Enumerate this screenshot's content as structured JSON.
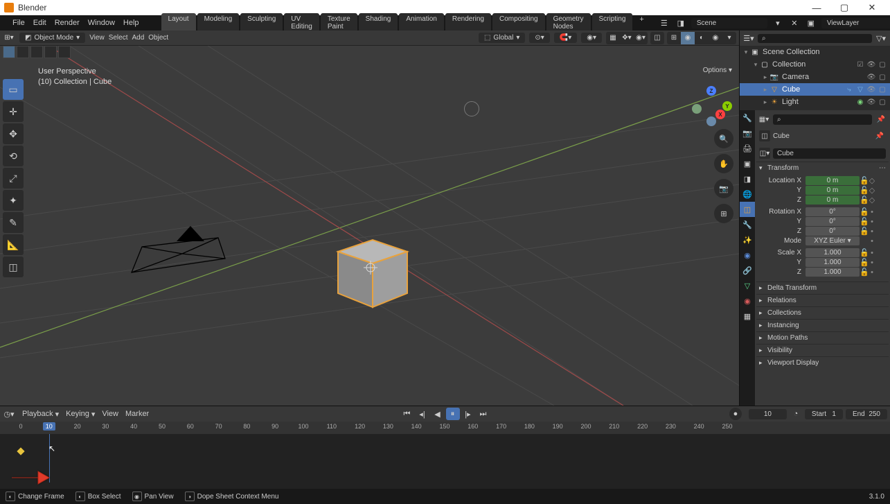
{
  "app": {
    "title": "Blender"
  },
  "windowControls": {
    "min": "—",
    "max": "▢",
    "close": "✕"
  },
  "menu": {
    "file": "File",
    "edit": "Edit",
    "render": "Render",
    "window": "Window",
    "help": "Help"
  },
  "workspaces": {
    "layout": "Layout",
    "modeling": "Modeling",
    "sculpting": "Sculpting",
    "uv": "UV Editing",
    "texture": "Texture Paint",
    "shading": "Shading",
    "animation": "Animation",
    "rendering": "Rendering",
    "compositing": "Compositing",
    "geonodes": "Geometry Nodes",
    "scripting": "Scripting",
    "add": "+"
  },
  "topbar": {
    "sceneLabel": "Scene",
    "viewLayer": "ViewLayer"
  },
  "viewportHeader": {
    "mode": "Object Mode",
    "view": "View",
    "select": "Select",
    "add": "Add",
    "object": "Object",
    "orientation": "Global",
    "options": "Options"
  },
  "overlay": {
    "line1": "User Perspective",
    "line2": "(10) Collection | Cube"
  },
  "navGizmo": {
    "x": "X",
    "y": "Y",
    "z": "Z"
  },
  "outliner": {
    "searchIcon": "⌕",
    "sceneCollection": "Scene Collection",
    "collection": "Collection",
    "camera": "Camera",
    "cube": "Cube",
    "light": "Light"
  },
  "properties": {
    "search": "",
    "objName": "Cube",
    "dataName": "Cube",
    "panels": {
      "transform": "Transform",
      "locX": "Location X",
      "locY": "Y",
      "locZ": "Z",
      "rotX": "Rotation X",
      "rotY": "Y",
      "rotZ": "Z",
      "mode": "Mode",
      "modeValue": "XYZ Euler",
      "scaleX": "Scale X",
      "scaleY": "Y",
      "scaleZ": "Z",
      "delta": "Delta Transform",
      "relations": "Relations",
      "collections": "Collections",
      "instancing": "Instancing",
      "motionPaths": "Motion Paths",
      "visibility": "Visibility",
      "viewportDisplay": "Viewport Display"
    },
    "values": {
      "locX": "0 m",
      "locY": "0 m",
      "locZ": "0 m",
      "rotX": "0°",
      "rotY": "0°",
      "rotZ": "0°",
      "scaleX": "1.000",
      "scaleY": "1.000",
      "scaleZ": "1.000"
    }
  },
  "timeline": {
    "playback": "Playback",
    "keying": "Keying",
    "view": "View",
    "marker": "Marker",
    "currentFrame": "10",
    "start": "Start",
    "startVal": "1",
    "end": "End",
    "endVal": "250",
    "ticks": [
      "0",
      "10",
      "20",
      "30",
      "40",
      "50",
      "60",
      "70",
      "80",
      "90",
      "100",
      "110",
      "120",
      "130",
      "140",
      "150",
      "160",
      "170",
      "180",
      "190",
      "200",
      "210",
      "220",
      "230",
      "240",
      "250"
    ]
  },
  "statusbar": {
    "changeFrame": "Change Frame",
    "boxSelect": "Box Select",
    "panView": "Pan View",
    "contextMenu": "Dope Sheet Context Menu",
    "version": "3.1.0"
  }
}
